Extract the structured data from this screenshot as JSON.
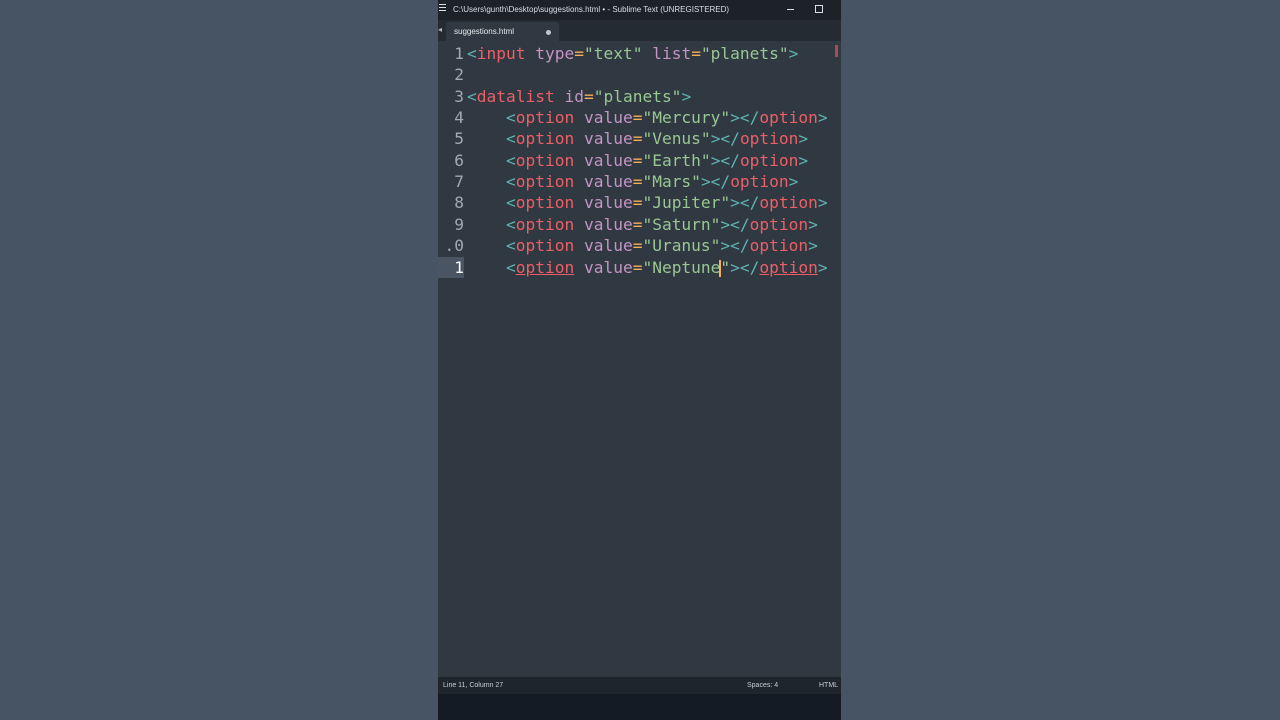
{
  "window": {
    "title": "C:\\Users\\gunth\\Desktop\\suggestions.html • - Sublime Text (UNREGISTERED)"
  },
  "tabs": [
    {
      "label": "suggestions.html",
      "dirty": true
    }
  ],
  "editor": {
    "active_line": 11,
    "lines": [
      {
        "number": "1"
      },
      {
        "number": "2"
      },
      {
        "number": "3"
      },
      {
        "number": "4"
      },
      {
        "number": "5"
      },
      {
        "number": "6"
      },
      {
        "number": "7"
      },
      {
        "number": "8"
      },
      {
        "number": "9"
      },
      {
        "number": ".0"
      },
      {
        "number": "1"
      }
    ],
    "code": {
      "input": {
        "tag": "input",
        "type_attr": "type",
        "type_value": "\"text\"",
        "list_attr": "list",
        "list_value": "\"planets\""
      },
      "datalist": {
        "tag": "datalist",
        "id_attr": "id",
        "id_value": "\"planets\"",
        "option_tag": "option",
        "value_attr": "value"
      },
      "options": [
        {
          "value": "\"Mercury\""
        },
        {
          "value": "\"Venus\""
        },
        {
          "value": "\"Earth\""
        },
        {
          "value": "\"Mars\""
        },
        {
          "value": "\"Jupiter\""
        },
        {
          "value": "\"Saturn\""
        },
        {
          "value": "\"Uranus\""
        },
        {
          "value_before_caret": "\"Neptune",
          "value_after_caret": "\""
        }
      ]
    }
  },
  "status_bar": {
    "position": "Line 11, Column 27",
    "indentation": "Spaces: 4",
    "syntax": "HTML"
  },
  "colors": {
    "background": "#475463",
    "editor_bg": "#303841",
    "tag": "#ec5f67",
    "attribute": "#c594c5",
    "string": "#99c794",
    "punctuation": "#5fb3b3",
    "operator": "#f9ae58"
  }
}
